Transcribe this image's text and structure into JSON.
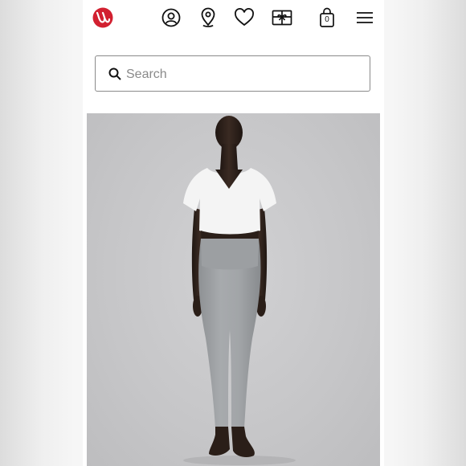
{
  "header": {
    "logo": "lululemon-logo",
    "icons": [
      "account-icon",
      "store-locator-icon",
      "wishlist-icon",
      "gift-card-icon",
      "bag-icon",
      "menu-icon"
    ],
    "bag_count": "0",
    "brand_color": "#d22030"
  },
  "search": {
    "placeholder": "Search",
    "value": ""
  },
  "hero": {
    "image": "model-wearing-white-cropped-tee-and-grey-leggings",
    "background_color": "#c8c8ca"
  }
}
